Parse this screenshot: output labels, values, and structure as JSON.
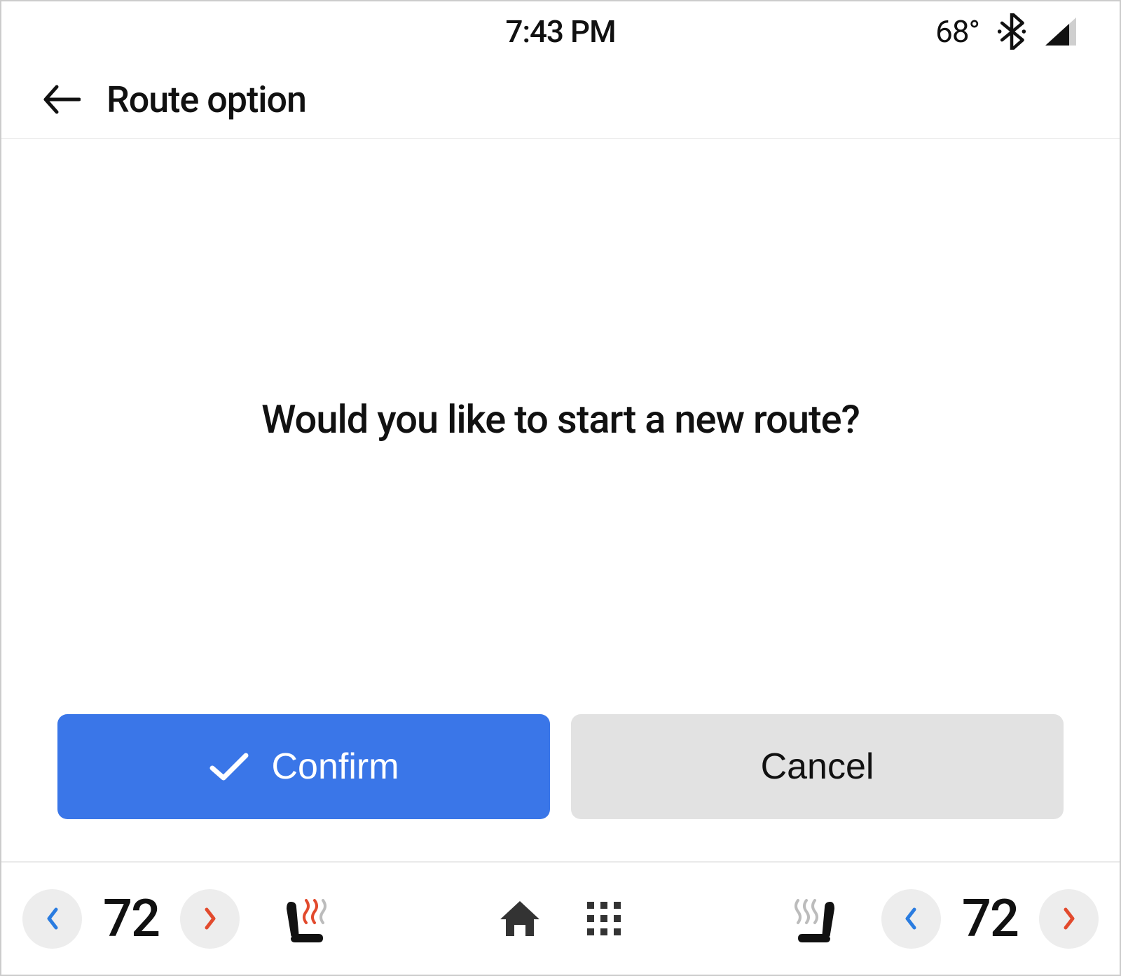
{
  "status": {
    "time": "7:43 PM",
    "outside_temp": "68°"
  },
  "header": {
    "title": "Route option"
  },
  "main": {
    "prompt": "Would you like to start a new route?",
    "confirm_label": "Confirm",
    "cancel_label": "Cancel"
  },
  "climate": {
    "left_temp": "72",
    "right_temp": "72"
  },
  "colors": {
    "primary": "#3a76e8",
    "chev_blue": "#2a7ce0",
    "chev_red": "#e24a2d"
  }
}
